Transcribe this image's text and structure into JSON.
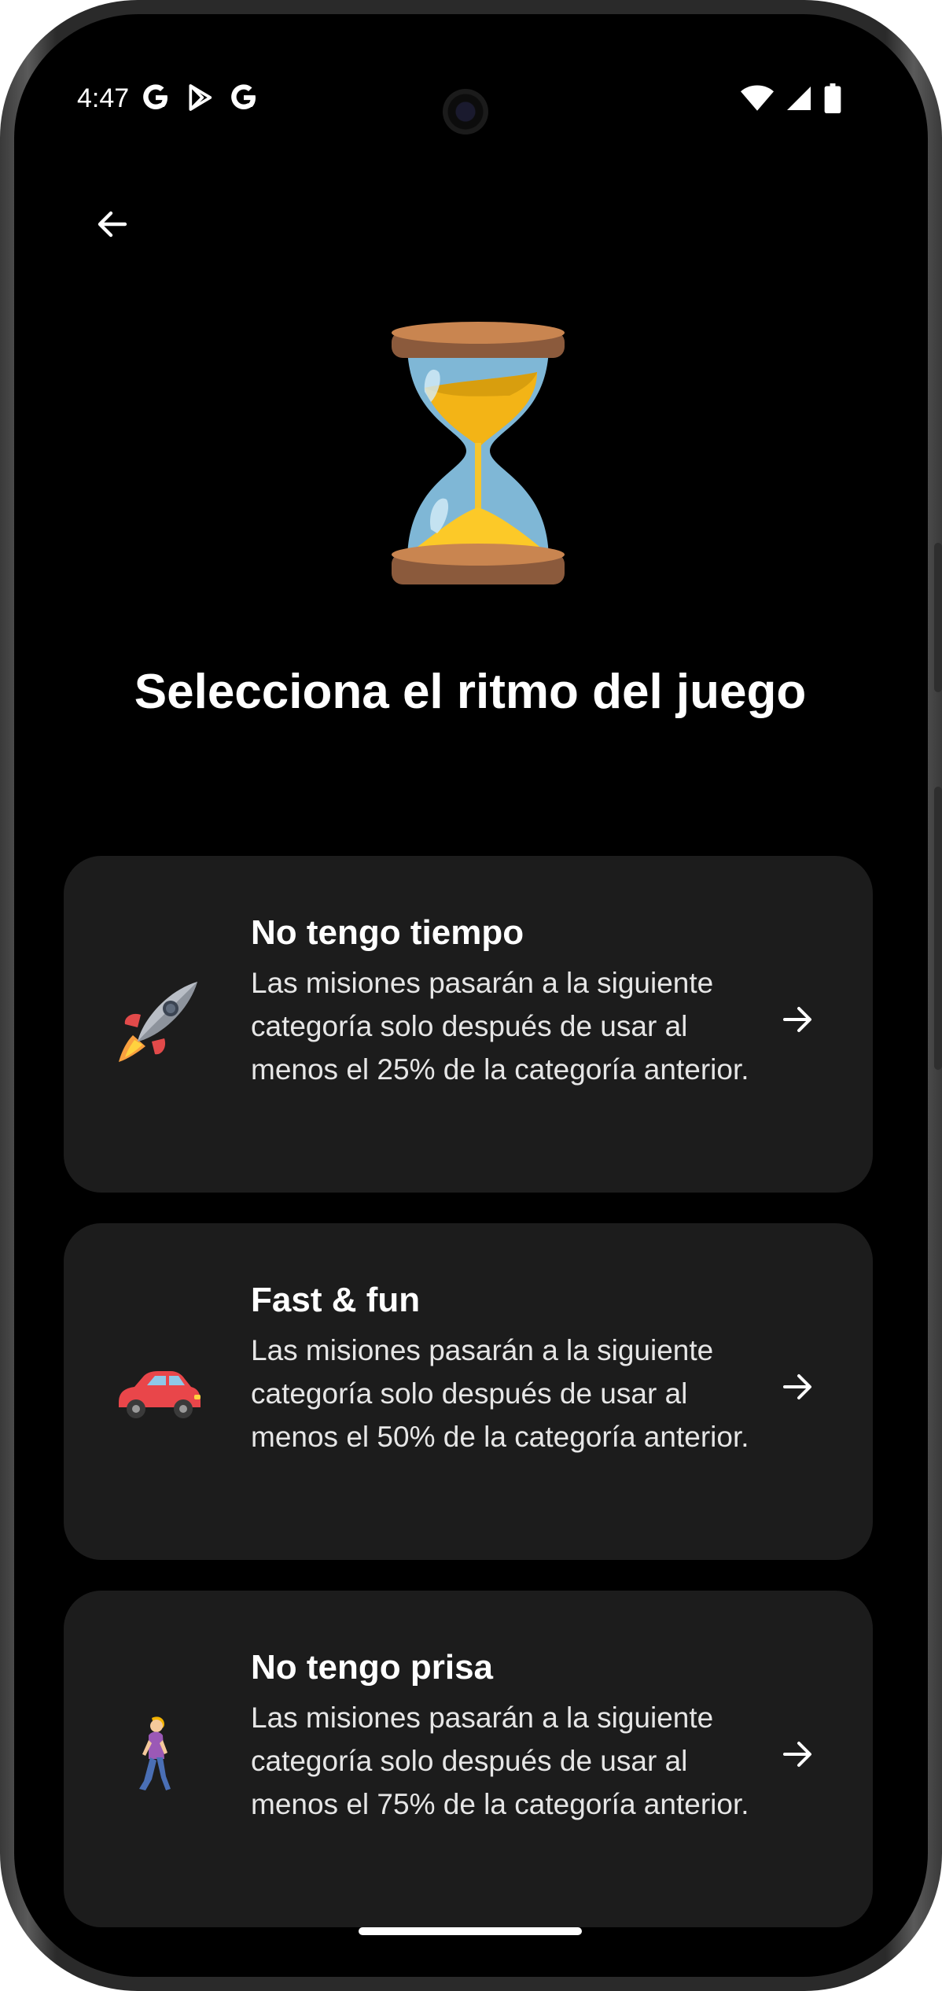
{
  "status_bar": {
    "time": "4:47",
    "left_icons": [
      "google-g-icon",
      "play-store-icon",
      "google-g-icon"
    ],
    "right_icons": [
      "wifi-icon",
      "cellular-signal-icon",
      "battery-icon"
    ]
  },
  "header": {
    "back_icon": "arrow-left-icon",
    "hero_icon": "hourglass-icon"
  },
  "title": "Selecciona el ritmo del juego",
  "options": [
    {
      "icon": "rocket-icon",
      "title": "No tengo tiempo",
      "description": "Las misiones pasarán a la siguiente categoría solo después de usar al menos el 25% de la categoría anterior."
    },
    {
      "icon": "car-icon",
      "title": "Fast & fun",
      "description": "Las misiones pasarán a la siguiente categoría solo después de usar al menos el 50% de la categoría anterior."
    },
    {
      "icon": "woman-walking-icon",
      "title": "No tengo prisa",
      "description": "Las misiones pasarán a la siguiente categoría solo después de usar al menos el 75% de la categoría anterior."
    }
  ],
  "colors": {
    "background": "#000000",
    "card": "#1c1c1c",
    "text": "#ffffff"
  }
}
